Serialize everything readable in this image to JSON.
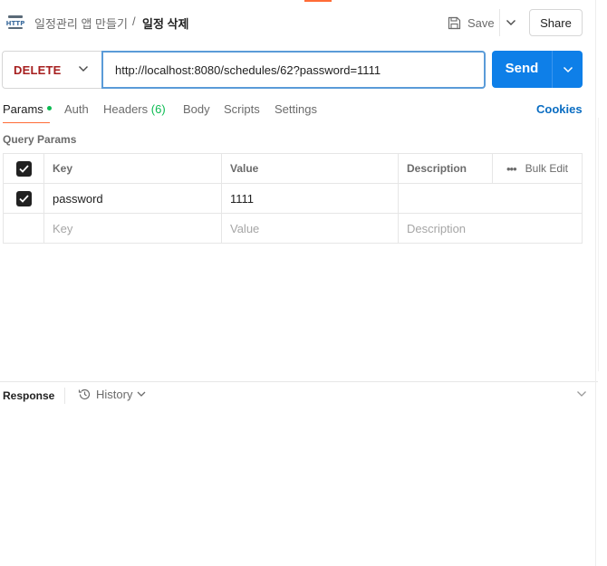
{
  "header": {
    "icon": "http-icon",
    "breadcrumb_parent": "일정관리 앱 만들기",
    "breadcrumb_separator": "/",
    "breadcrumb_current": "일정 삭제",
    "save_label": "Save",
    "share_label": "Share"
  },
  "request": {
    "method": "DELETE",
    "url": "http://localhost:8080/schedules/62?password=1111",
    "send_label": "Send"
  },
  "tabs": {
    "params": "Params",
    "auth": "Auth",
    "headers": "Headers",
    "headers_count": "(6)",
    "body": "Body",
    "scripts": "Scripts",
    "settings": "Settings",
    "cookies": "Cookies"
  },
  "query_params": {
    "title": "Query Params",
    "columns": {
      "key": "Key",
      "value": "Value",
      "description": "Description",
      "bulk_edit": "Bulk Edit"
    },
    "rows": [
      {
        "checked": true,
        "key": "password",
        "value": "1111",
        "description": ""
      }
    ],
    "placeholders": {
      "key": "Key",
      "value": "Value",
      "description": "Description"
    }
  },
  "response": {
    "label": "Response",
    "history_label": "History"
  },
  "colors": {
    "method_delete": "#a61e1e",
    "send_button": "#0e7fe8",
    "url_focus_border": "#5a9bd8",
    "active_tab_underline": "#ff6c37",
    "params_dot": "#0cbb52",
    "cookies_link": "#0a6dc2"
  }
}
